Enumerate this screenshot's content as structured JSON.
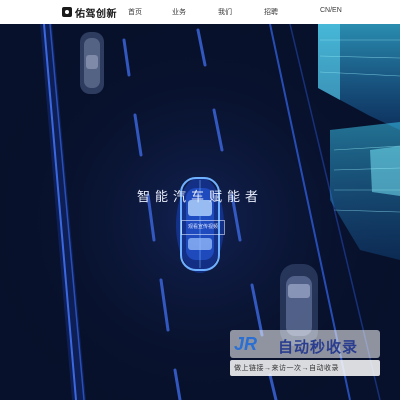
{
  "brand": {
    "name": "佑驾创新"
  },
  "nav": {
    "home": "首页",
    "business": "业务",
    "about": "我们",
    "jobs": "招聘",
    "language": "CN/EN"
  },
  "hero": {
    "title": "智能汽车赋能者",
    "button_label": "观看宣传视频"
  },
  "watermark": {
    "logo_letters": "JR",
    "title": "自动秒收录",
    "slogan": "做上链接→来访一次→自动收录"
  },
  "colors": {
    "header_bg": "#ffffff",
    "scene_bg": "#081433",
    "road_line": "#2f5bd6",
    "glow_accent": "#3fb6ff",
    "watermark_blue": "#2a6fd1"
  },
  "icons": {
    "logo": "brand-logo-icon",
    "car": "car-icon"
  }
}
